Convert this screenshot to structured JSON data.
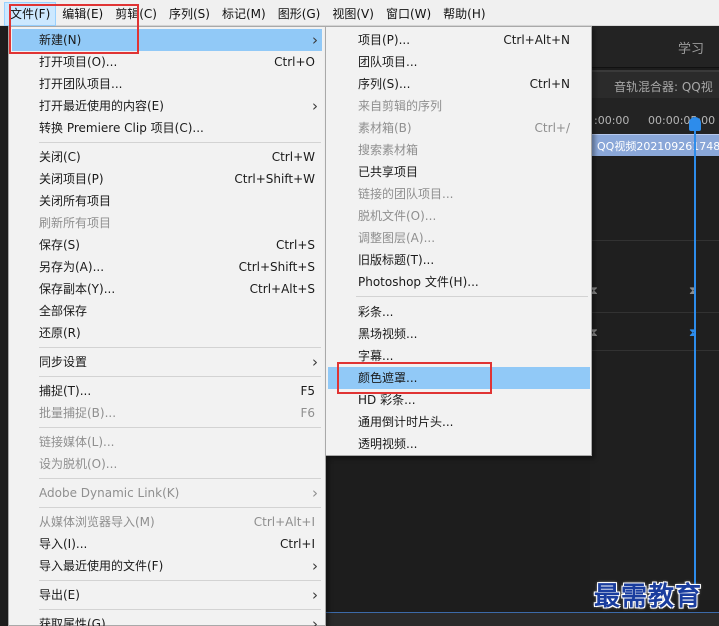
{
  "menubar": {
    "items": [
      {
        "label": "文件(F)",
        "active": true
      },
      {
        "label": "编辑(E)",
        "active": false
      },
      {
        "label": "剪辑(C)",
        "active": false
      },
      {
        "label": "序列(S)",
        "active": false
      },
      {
        "label": "标记(M)",
        "active": false
      },
      {
        "label": "图形(G)",
        "active": false
      },
      {
        "label": "视图(V)",
        "active": false
      },
      {
        "label": "窗口(W)",
        "active": false
      },
      {
        "label": "帮助(H)",
        "active": false
      }
    ]
  },
  "background": {
    "learn_label": "学习",
    "mixer_label": "音轨混合器: QQ视",
    "timecodes": [
      ":00:00",
      "00:00:05:00"
    ],
    "clip_label": "QQ视频202109261748"
  },
  "file_menu": {
    "items": [
      {
        "label": "新建(N)",
        "shortcut": "",
        "submenu": true,
        "disabled": false,
        "highlight": true
      },
      {
        "label": "打开项目(O)...",
        "shortcut": "Ctrl+O",
        "submenu": false,
        "disabled": false
      },
      {
        "label": "打开团队项目...",
        "shortcut": "",
        "submenu": false,
        "disabled": false
      },
      {
        "label": "打开最近使用的内容(E)",
        "shortcut": "",
        "submenu": true,
        "disabled": false
      },
      {
        "label": "转换 Premiere Clip 项目(C)...",
        "shortcut": "",
        "submenu": false,
        "disabled": false
      },
      {
        "separator": true
      },
      {
        "label": "关闭(C)",
        "shortcut": "Ctrl+W",
        "submenu": false,
        "disabled": false
      },
      {
        "label": "关闭项目(P)",
        "shortcut": "Ctrl+Shift+W",
        "submenu": false,
        "disabled": false
      },
      {
        "label": "关闭所有项目",
        "shortcut": "",
        "submenu": false,
        "disabled": false
      },
      {
        "label": "刷新所有项目",
        "shortcut": "",
        "submenu": false,
        "disabled": true
      },
      {
        "label": "保存(S)",
        "shortcut": "Ctrl+S",
        "submenu": false,
        "disabled": false
      },
      {
        "label": "另存为(A)...",
        "shortcut": "Ctrl+Shift+S",
        "submenu": false,
        "disabled": false
      },
      {
        "label": "保存副本(Y)...",
        "shortcut": "Ctrl+Alt+S",
        "submenu": false,
        "disabled": false
      },
      {
        "label": "全部保存",
        "shortcut": "",
        "submenu": false,
        "disabled": false
      },
      {
        "label": "还原(R)",
        "shortcut": "",
        "submenu": false,
        "disabled": false
      },
      {
        "separator": true
      },
      {
        "label": "同步设置",
        "shortcut": "",
        "submenu": true,
        "disabled": false
      },
      {
        "separator": true
      },
      {
        "label": "捕捉(T)...",
        "shortcut": "F5",
        "submenu": false,
        "disabled": false
      },
      {
        "label": "批量捕捉(B)...",
        "shortcut": "F6",
        "submenu": false,
        "disabled": true
      },
      {
        "separator": true
      },
      {
        "label": "链接媒体(L)...",
        "shortcut": "",
        "submenu": false,
        "disabled": true
      },
      {
        "label": "设为脱机(O)...",
        "shortcut": "",
        "submenu": false,
        "disabled": true
      },
      {
        "separator": true
      },
      {
        "label": "Adobe Dynamic Link(K)",
        "shortcut": "",
        "submenu": true,
        "disabled": true
      },
      {
        "separator": true
      },
      {
        "label": "从媒体浏览器导入(M)",
        "shortcut": "Ctrl+Alt+I",
        "submenu": false,
        "disabled": true
      },
      {
        "label": "导入(I)...",
        "shortcut": "Ctrl+I",
        "submenu": false,
        "disabled": false
      },
      {
        "label": "导入最近使用的文件(F)",
        "shortcut": "",
        "submenu": true,
        "disabled": false
      },
      {
        "separator": true
      },
      {
        "label": "导出(E)",
        "shortcut": "",
        "submenu": true,
        "disabled": false
      },
      {
        "separator": true
      },
      {
        "label": "获取属性(G)",
        "shortcut": "",
        "submenu": true,
        "disabled": false
      }
    ]
  },
  "new_submenu": {
    "items": [
      {
        "label": "项目(P)...",
        "shortcut": "Ctrl+Alt+N",
        "disabled": false
      },
      {
        "label": "团队项目...",
        "shortcut": "",
        "disabled": false
      },
      {
        "label": "序列(S)...",
        "shortcut": "Ctrl+N",
        "disabled": false
      },
      {
        "label": "来自剪辑的序列",
        "shortcut": "",
        "disabled": true
      },
      {
        "label": "素材箱(B)",
        "shortcut": "Ctrl+/",
        "disabled": true
      },
      {
        "label": "搜索素材箱",
        "shortcut": "",
        "disabled": true
      },
      {
        "label": "已共享项目",
        "shortcut": "",
        "disabled": false
      },
      {
        "label": "链接的团队项目...",
        "shortcut": "",
        "disabled": true
      },
      {
        "label": "脱机文件(O)...",
        "shortcut": "",
        "disabled": true
      },
      {
        "label": "调整图层(A)...",
        "shortcut": "",
        "disabled": true
      },
      {
        "label": "旧版标题(T)...",
        "shortcut": "",
        "disabled": false
      },
      {
        "label": "Photoshop 文件(H)...",
        "shortcut": "",
        "disabled": false
      },
      {
        "separator": true
      },
      {
        "label": "彩条...",
        "shortcut": "",
        "disabled": false
      },
      {
        "label": "黑场视频...",
        "shortcut": "",
        "disabled": false
      },
      {
        "label": "字幕...",
        "shortcut": "",
        "disabled": false
      },
      {
        "label": "颜色遮罩...",
        "shortcut": "",
        "disabled": false,
        "highlight": true
      },
      {
        "label": "HD 彩条...",
        "shortcut": "",
        "disabled": false
      },
      {
        "label": "通用倒计时片头...",
        "shortcut": "",
        "disabled": false
      },
      {
        "label": "透明视频...",
        "shortcut": "",
        "disabled": false
      }
    ]
  },
  "watermark": {
    "text": "最需教育"
  },
  "colors": {
    "menu_bg": "#f2f2f2",
    "highlight": "#91c9f7",
    "annotation_red": "#e03434",
    "timeline_blue": "#2d8ceb"
  }
}
